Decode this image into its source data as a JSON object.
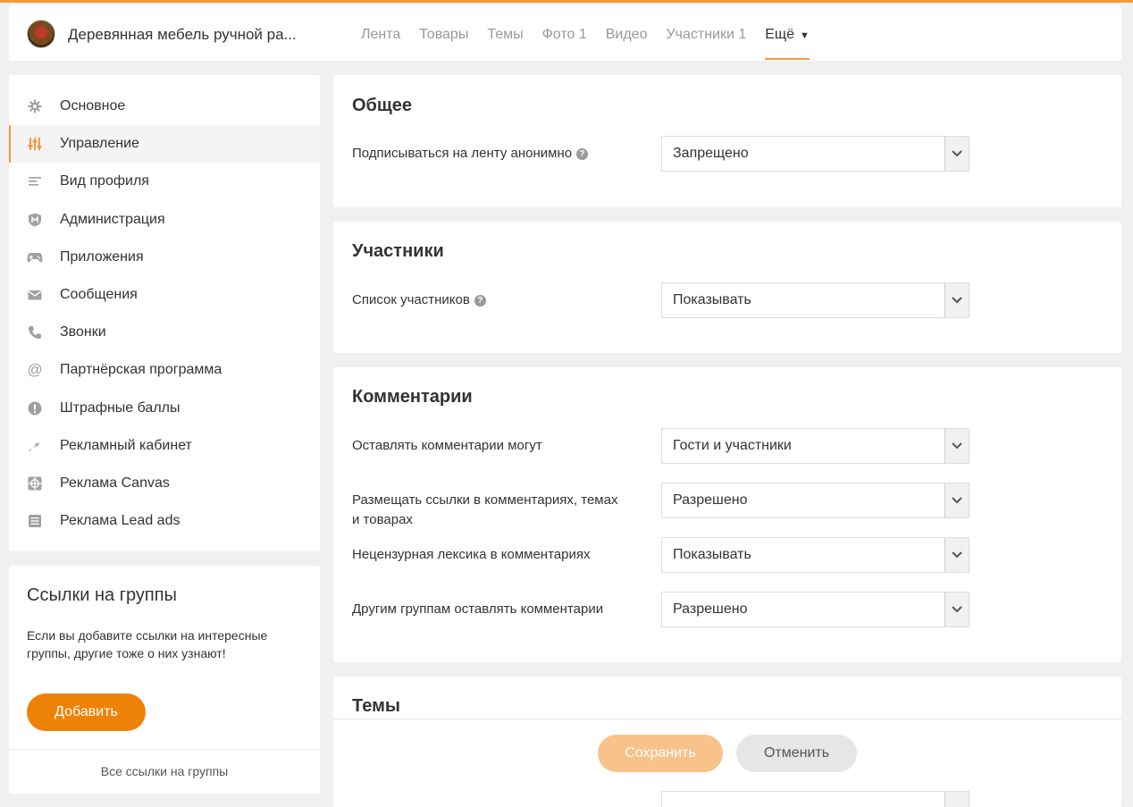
{
  "header": {
    "group_name": "Деревянная мебель ручной ра...",
    "tabs": [
      {
        "label": "Лента"
      },
      {
        "label": "Товары"
      },
      {
        "label": "Темы"
      },
      {
        "label": "Фото 1"
      },
      {
        "label": "Видео"
      },
      {
        "label": "Участники 1"
      },
      {
        "label": "Ещё"
      }
    ]
  },
  "sidebar": {
    "items": [
      {
        "label": "Основное",
        "icon": "gear-icon"
      },
      {
        "label": "Управление",
        "icon": "sliders-icon"
      },
      {
        "label": "Вид профиля",
        "icon": "lines-icon"
      },
      {
        "label": "Администрация",
        "icon": "shield-icon"
      },
      {
        "label": "Приложения",
        "icon": "gamepad-icon"
      },
      {
        "label": "Сообщения",
        "icon": "envelope-icon"
      },
      {
        "label": "Звонки",
        "icon": "phone-icon"
      },
      {
        "label": "Партнёрская программа",
        "icon": "at-icon"
      },
      {
        "label": "Штрафные баллы",
        "icon": "alert-icon"
      },
      {
        "label": "Рекламный кабинет",
        "icon": "arrow-icon"
      },
      {
        "label": "Реклама Canvas",
        "icon": "canvas-icon"
      },
      {
        "label": "Реклама Lead ads",
        "icon": "list-icon"
      }
    ]
  },
  "links": {
    "title": "Ссылки на группы",
    "text": "Если вы добавите ссылки на интересные группы, другие тоже о них узнают!",
    "add_label": "Добавить",
    "all_label": "Все ссылки на группы"
  },
  "sections": {
    "general": {
      "title": "Общее",
      "rows": [
        {
          "label": "Подписываться на ленту анонимно",
          "value": "Запрещено"
        }
      ]
    },
    "members": {
      "title": "Участники",
      "rows": [
        {
          "label": "Список участников",
          "value": "Показывать"
        }
      ]
    },
    "comments": {
      "title": "Комментарии",
      "rows": [
        {
          "label": "Оставлять комментарии могут",
          "value": "Гости и участники"
        },
        {
          "label": "Размещать ссылки в комментариях, темах и товарах",
          "value": "Разрешено"
        },
        {
          "label": "Нецензурная лексика в комментариях",
          "value": "Показывать"
        },
        {
          "label": "Другим группам оставлять комментарии",
          "value": "Разрешено"
        }
      ]
    },
    "topics": {
      "title": "Темы"
    }
  },
  "savebar": {
    "save_label": "Сохранить",
    "cancel_label": "Отменить"
  },
  "colors": {
    "accent": "#ee8208",
    "accent_light": "#f8c28b",
    "top_line": "#f39a3c"
  }
}
